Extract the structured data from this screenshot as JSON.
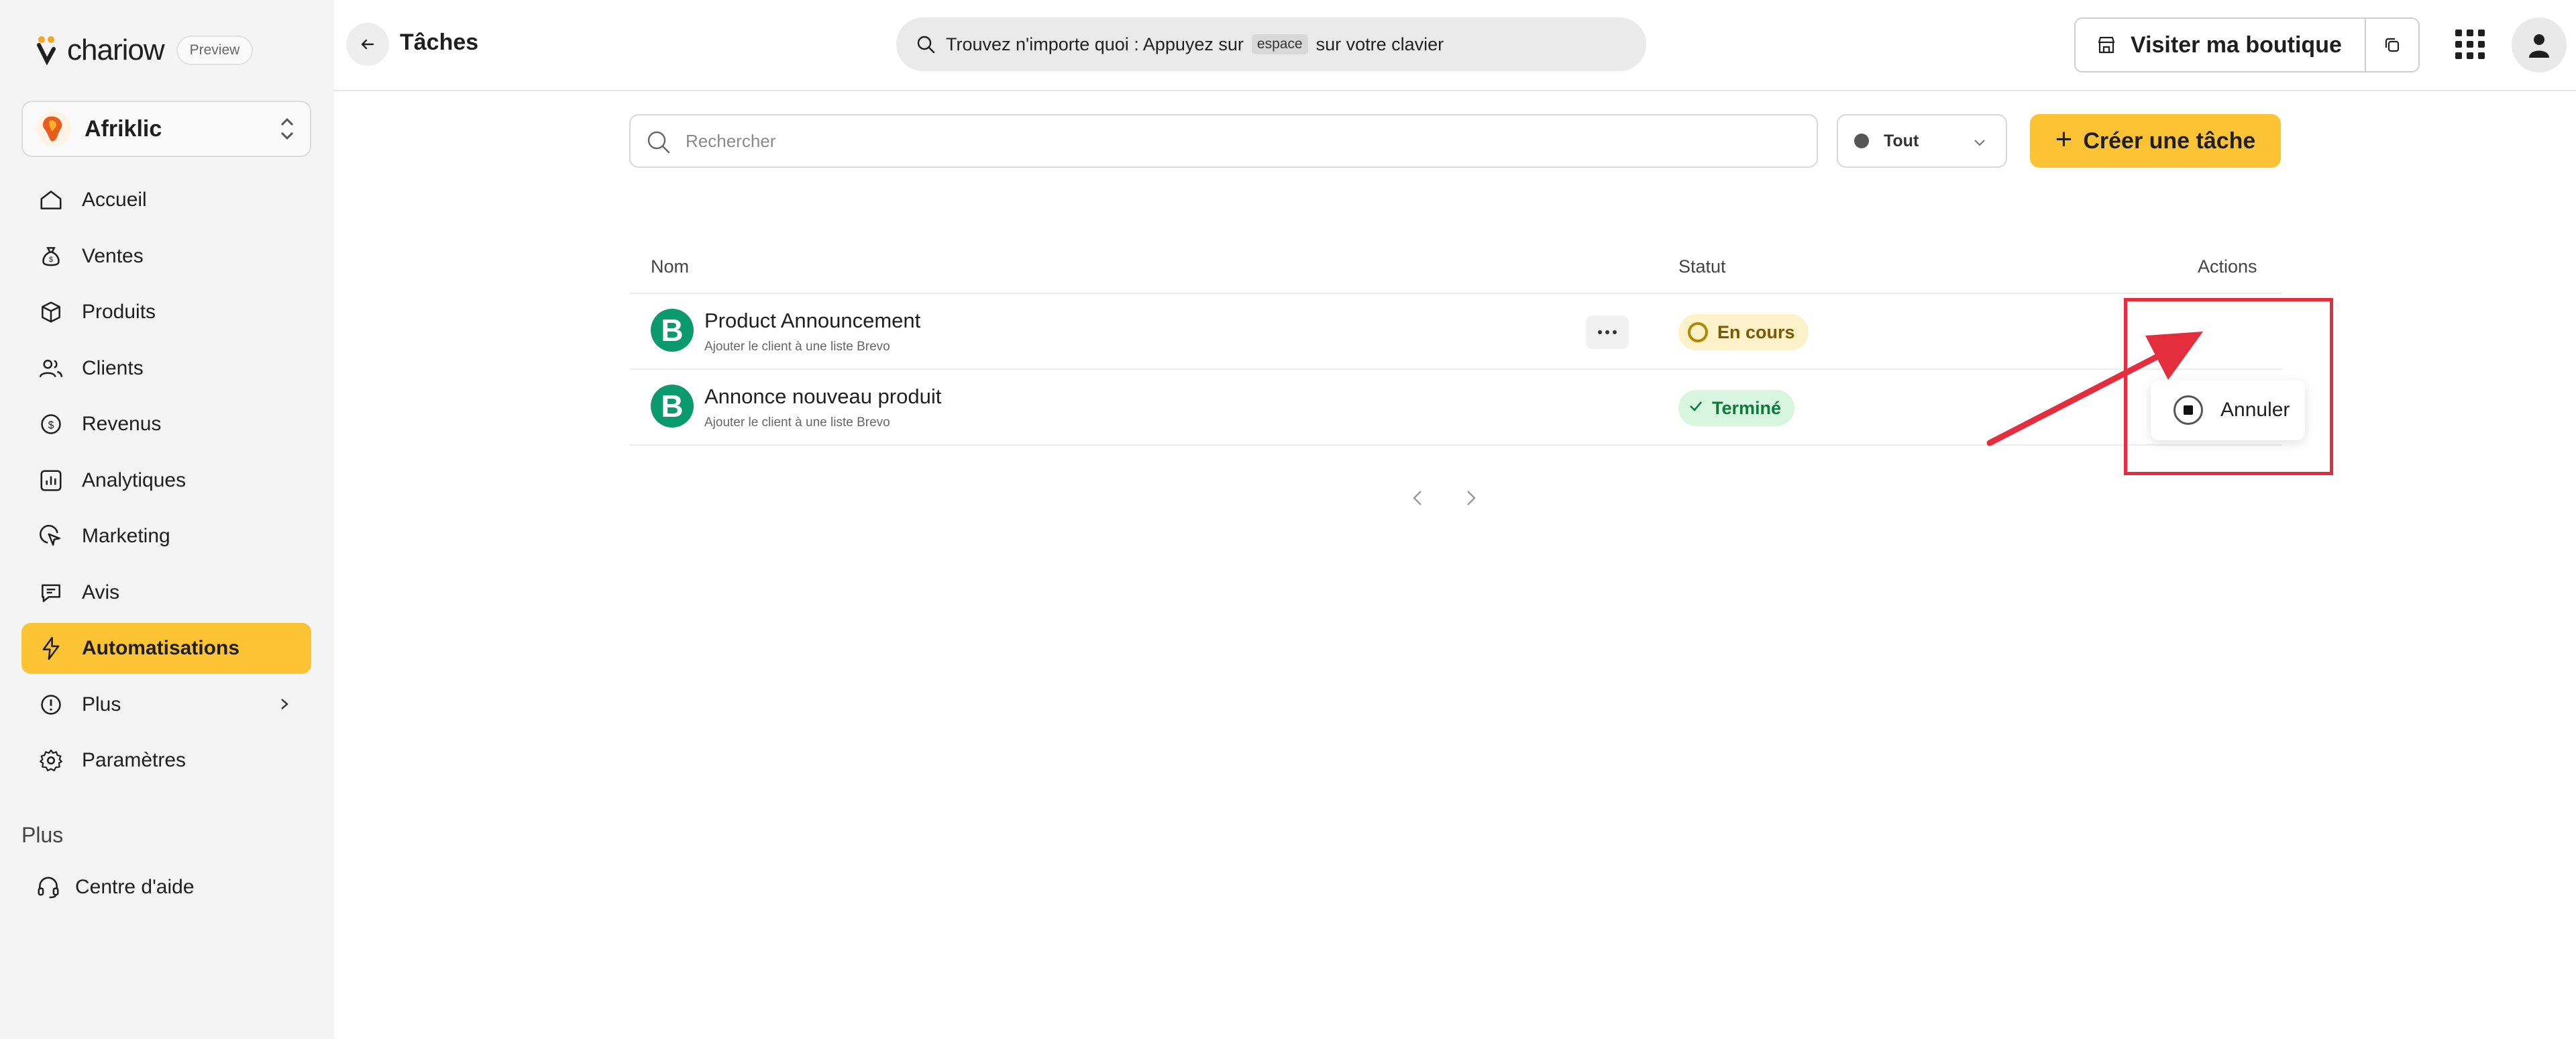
{
  "brand": {
    "name": "chariow",
    "badge": "Preview"
  },
  "store": {
    "name": "Afriklic"
  },
  "sidebar": {
    "items": [
      {
        "label": "Accueil",
        "icon": "home-icon"
      },
      {
        "label": "Ventes",
        "icon": "money-bag-icon"
      },
      {
        "label": "Produits",
        "icon": "box-icon"
      },
      {
        "label": "Clients",
        "icon": "users-icon"
      },
      {
        "label": "Revenus",
        "icon": "coin-icon"
      },
      {
        "label": "Analytiques",
        "icon": "bar-chart-icon"
      },
      {
        "label": "Marketing",
        "icon": "cursor-icon"
      },
      {
        "label": "Avis",
        "icon": "message-icon"
      },
      {
        "label": "Automatisations",
        "icon": "lightning-icon",
        "active": true
      },
      {
        "label": "Plus",
        "icon": "info-circle-icon"
      },
      {
        "label": "Paramètres",
        "icon": "gear-icon"
      }
    ],
    "section_title": "Plus",
    "help_label": "Centre d'aide"
  },
  "header": {
    "title": "Tâches",
    "search_prefix": "Trouvez n'importe quoi : Appuyez sur",
    "search_key": "espace",
    "search_suffix": "sur votre clavier",
    "visit_label": "Visiter ma boutique"
  },
  "filters": {
    "search_placeholder": "Rechercher",
    "status_filter": "Tout",
    "create_label": "Créer une tâche"
  },
  "table": {
    "columns": {
      "name": "Nom",
      "status": "Statut",
      "actions": "Actions"
    },
    "rows": [
      {
        "name": "Product Announcement",
        "subtitle": "Ajouter le client à une liste Brevo",
        "status": "En cours",
        "status_type": "pending",
        "provider_letter": "B"
      },
      {
        "name": "Annonce nouveau produit",
        "subtitle": "Ajouter le client à une liste Brevo",
        "status": "Terminé",
        "status_type": "done",
        "provider_letter": "B"
      }
    ]
  },
  "actions_menu": {
    "cancel_label": "Annuler"
  },
  "colors": {
    "accent": "#fcc434",
    "brevo": "#0b996e",
    "annotation": "#e52e3d"
  }
}
